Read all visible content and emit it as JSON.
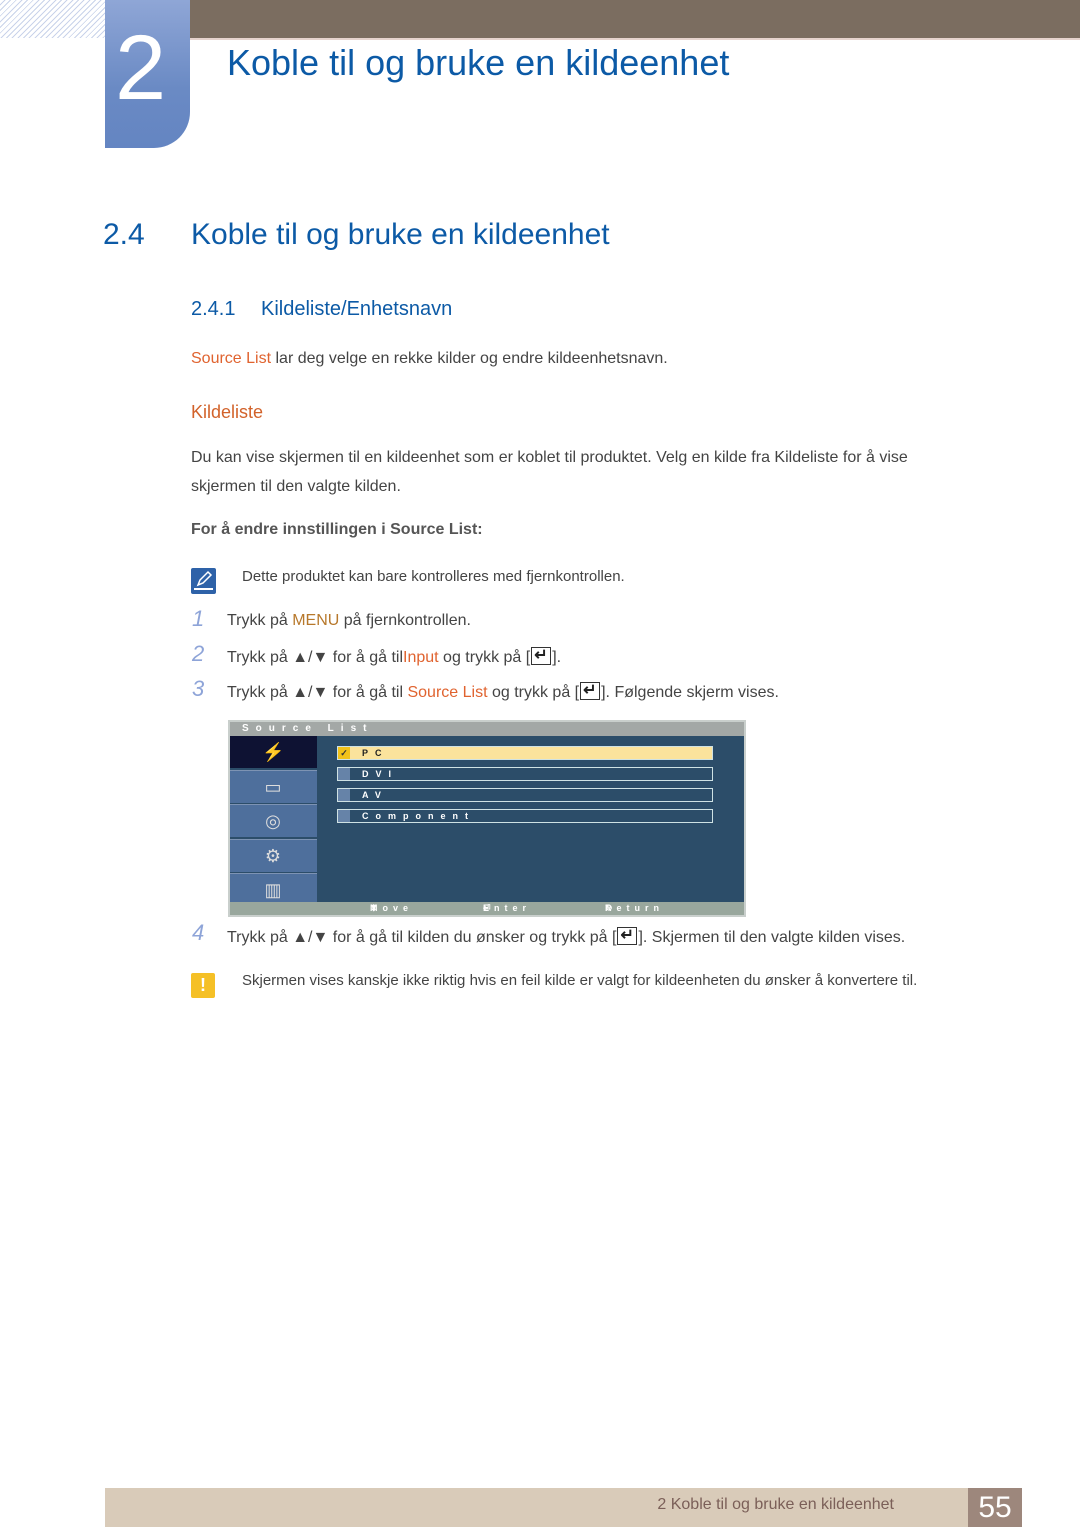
{
  "chapter": {
    "number": "2",
    "title": "Koble til og bruke en kildeenhet"
  },
  "section": {
    "number": "2.4",
    "title": "Koble til og bruke en kildeenhet"
  },
  "subsection": {
    "number": "2.4.1",
    "title": "Kildeliste/Enhetsnavn"
  },
  "intro": {
    "link": "Source List",
    "text": " lar deg velge en rekke kilder og endre kildeenhetsnavn."
  },
  "kildeliste": {
    "heading": "Kildeliste",
    "para_line1": "Du kan vise skjermen til en kildeenhet som er koblet til produktet. Velg en kilde fra Kildeliste for å vise",
    "para_line2": "skjermen til den valgte kilden.",
    "label": "For å endre innstillingen i Source List:"
  },
  "note": {
    "icon": "pencil-note-icon",
    "text": "Dette produktet kan bare kontrolleres med fjernkontrollen."
  },
  "steps": [
    {
      "num": "1",
      "pre": "Trykk på ",
      "key": "MENU",
      "post": " på fjernkontrollen."
    },
    {
      "num": "2",
      "pre": "Trykk på ▲/▼ for å gå til",
      "key": "Input",
      "post": " og trykk på [",
      "end": "]."
    },
    {
      "num": "3",
      "pre": "Trykk på ▲/▼ for å gå til ",
      "key": "Source List",
      "post": " og trykk på [",
      "end": "]. Følgende skjerm vises."
    },
    {
      "num": "4",
      "pre": "Trykk på ▲/▼ for å gå til kilden du ønsker og trykk på [",
      "end": "]. Skjermen til den valgte kilden vises."
    }
  ],
  "osd": {
    "title": "Source List",
    "side_icons": [
      "input-icon",
      "picture-icon",
      "sound-icon",
      "setup-icon",
      "multi-control-icon"
    ],
    "items": [
      {
        "label": "PC",
        "selected": true,
        "mark": "✓"
      },
      {
        "label": "DVI",
        "selected": false
      },
      {
        "label": "AV",
        "selected": false
      },
      {
        "label": "Component",
        "selected": false
      }
    ],
    "footer": {
      "move": "Move",
      "enter": "Enter",
      "return": "Return"
    }
  },
  "warning": {
    "icon": "caution-icon",
    "text": "Skjermen vises kanskje ikke riktig hvis en feil kilde er valgt for kildeenheten du ønsker å konvertere til."
  },
  "footer": {
    "text": "2 Koble til og bruke en kildeenhet",
    "page": "55"
  }
}
